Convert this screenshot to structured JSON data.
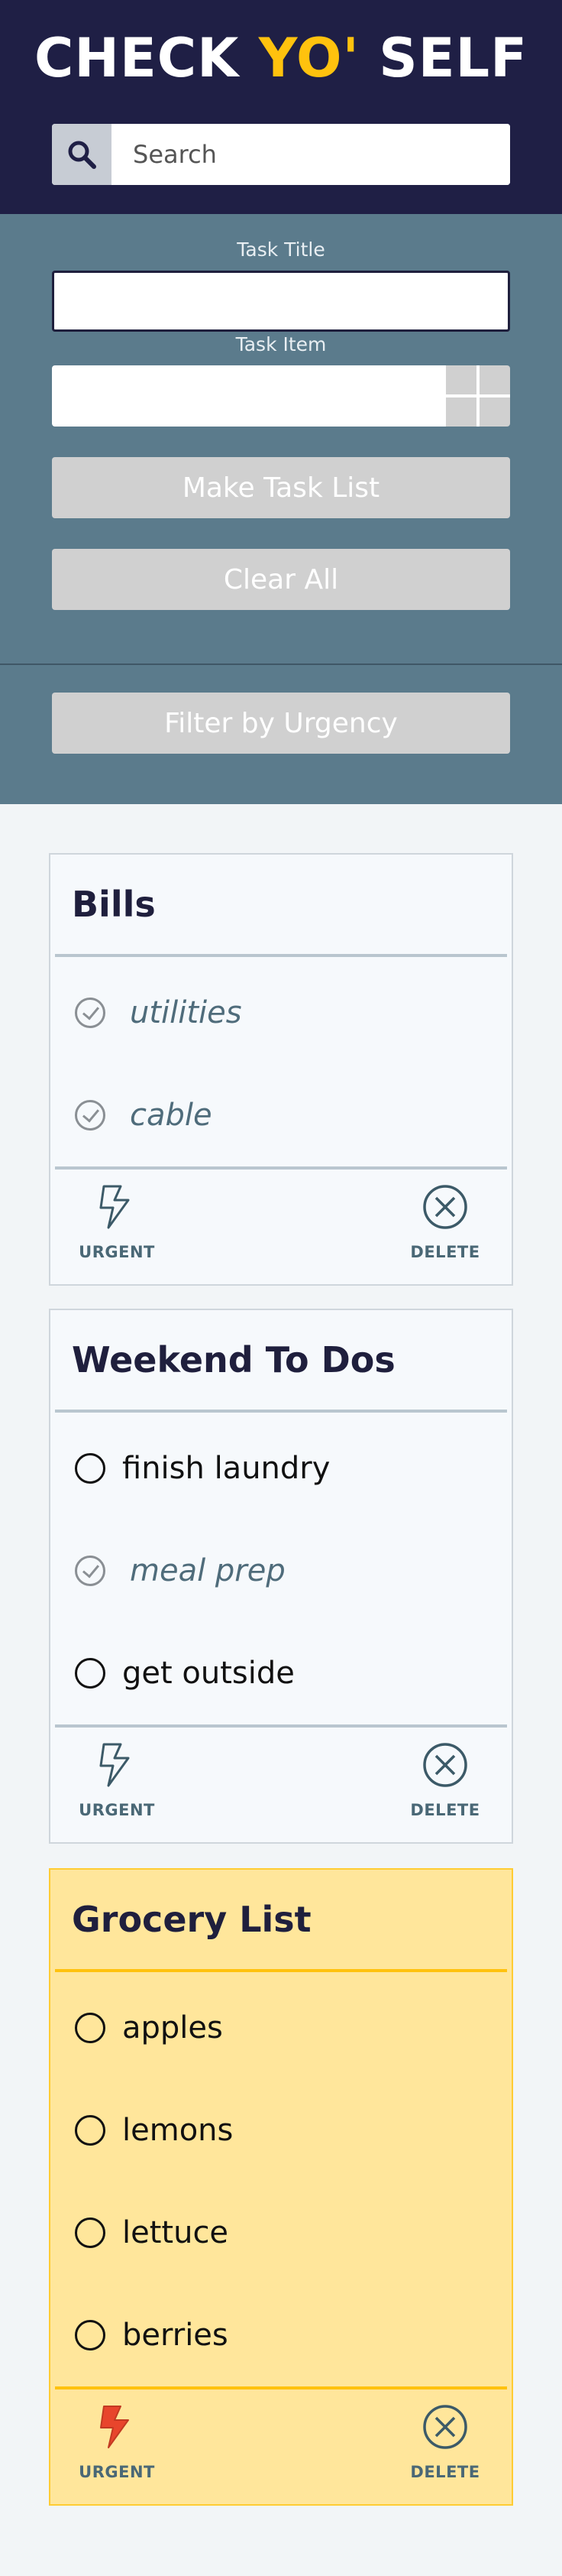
{
  "header": {
    "title_part1": "CHECK ",
    "title_accent": "YO'",
    "title_part2": " SELF",
    "search": {
      "placeholder": "Search",
      "icon": "search-icon"
    }
  },
  "form": {
    "task_title_label": "Task Title",
    "task_item_label": "Task Item",
    "make_task_list_label": "Make Task List",
    "clear_all_label": "Clear All",
    "filter_label": "Filter by Urgency"
  },
  "colors": {
    "navy": "#1f1f45",
    "accent_yellow": "#ffc20e",
    "panel_slate": "#5b7b8c",
    "urgent_card": "#ffe69b",
    "urgent_icon": "#e8452c"
  },
  "cards": [
    {
      "title": "Bills",
      "urgent": false,
      "tasks": [
        {
          "text": "utilities",
          "checked": true
        },
        {
          "text": "cable",
          "checked": true
        }
      ],
      "urgent_label": "URGENT",
      "delete_label": "DELETE"
    },
    {
      "title": "Weekend To Dos",
      "urgent": false,
      "tasks": [
        {
          "text": "finish laundry",
          "checked": false
        },
        {
          "text": "meal prep",
          "checked": true
        },
        {
          "text": "get outside",
          "checked": false
        }
      ],
      "urgent_label": "URGENT",
      "delete_label": "DELETE"
    },
    {
      "title": "Grocery List",
      "urgent": true,
      "tasks": [
        {
          "text": "apples",
          "checked": false
        },
        {
          "text": "lemons",
          "checked": false
        },
        {
          "text": "lettuce",
          "checked": false
        },
        {
          "text": "berries",
          "checked": false
        }
      ],
      "urgent_label": "URGENT",
      "delete_label": "DELETE"
    }
  ]
}
